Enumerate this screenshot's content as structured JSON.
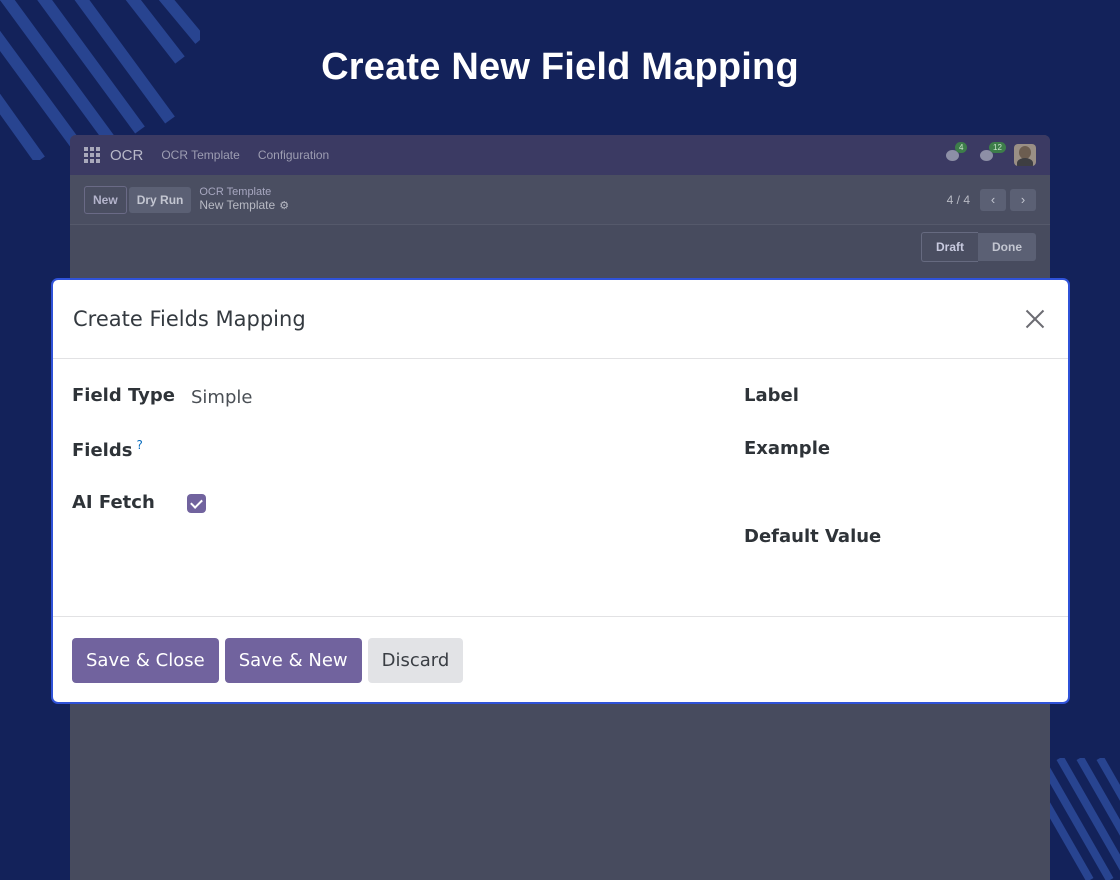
{
  "hero": {
    "title": "Create New Field Mapping"
  },
  "app": {
    "nav": {
      "app_name": "OCR",
      "items": [
        "OCR Template",
        "Configuration"
      ],
      "messages_badge": "4",
      "activities_badge": "12"
    },
    "control": {
      "new_label": "New",
      "dry_run_label": "Dry Run",
      "breadcrumb_parent": "OCR Template",
      "breadcrumb_current": "New Template",
      "pager": "4 / 4"
    },
    "status": {
      "stages": [
        "Draft",
        "Done"
      ],
      "active": "Draft"
    }
  },
  "modal": {
    "title": "Create Fields Mapping",
    "fields": {
      "field_type_label": "Field Type",
      "field_type_value": "Simple",
      "fields_label": "Fields",
      "fields_help": "?",
      "ai_fetch_label": "AI Fetch",
      "ai_fetch_checked": true,
      "label_label": "Label",
      "example_label": "Example",
      "default_value_label": "Default Value"
    },
    "footer": {
      "save_close": "Save & Close",
      "save_new": "Save & New",
      "discard": "Discard"
    }
  },
  "colors": {
    "background": "#13225a",
    "accent": "#71639e",
    "modal_border": "#2f52d8"
  }
}
